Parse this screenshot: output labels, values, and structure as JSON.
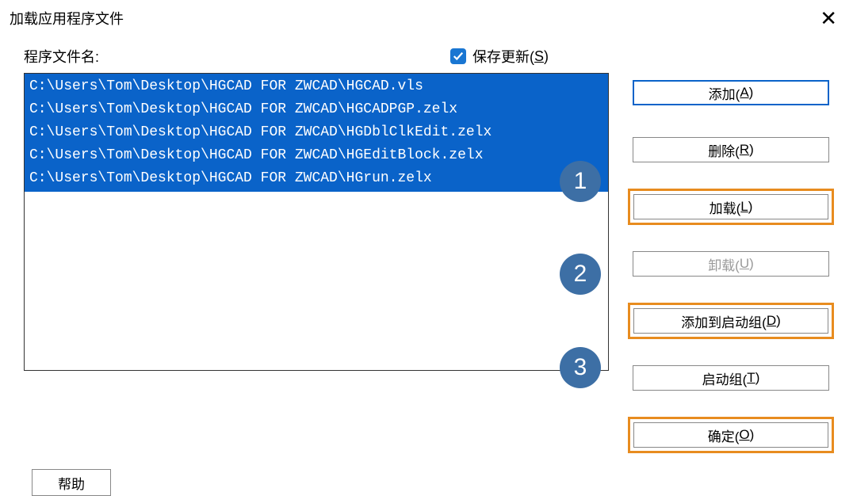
{
  "title": "加载应用程序文件",
  "file_label": "程序文件名:",
  "checkbox_label_pre": "保存更新(",
  "checkbox_hotkey": "S",
  "checkbox_label_post": ")",
  "files": [
    "C:\\Users\\Tom\\Desktop\\HGCAD FOR ZWCAD\\HGCAD.vls",
    "C:\\Users\\Tom\\Desktop\\HGCAD FOR ZWCAD\\HGCADPGP.zelx",
    "C:\\Users\\Tom\\Desktop\\HGCAD FOR ZWCAD\\HGDblClkEdit.zelx",
    "C:\\Users\\Tom\\Desktop\\HGCAD FOR ZWCAD\\HGEditBlock.zelx",
    "C:\\Users\\Tom\\Desktop\\HGCAD FOR ZWCAD\\HGrun.zelx"
  ],
  "buttons": {
    "add": {
      "pre": "添加(",
      "hot": "A",
      "post": ")"
    },
    "delete": {
      "pre": "删除(",
      "hot": "R",
      "post": ")"
    },
    "load": {
      "pre": "加载(",
      "hot": "L",
      "post": ")"
    },
    "unload": {
      "pre": "卸载(",
      "hot": "U",
      "post": ")"
    },
    "addgroup": {
      "pre": "添加到启动组(",
      "hot": "D",
      "post": ")"
    },
    "startgroup": {
      "pre": "启动组(",
      "hot": "T",
      "post": ")"
    },
    "ok": {
      "pre": "确定(",
      "hot": "O",
      "post": ")"
    }
  },
  "help_label": "帮助",
  "badges": {
    "n1": "1",
    "n2": "2",
    "n3": "3"
  }
}
